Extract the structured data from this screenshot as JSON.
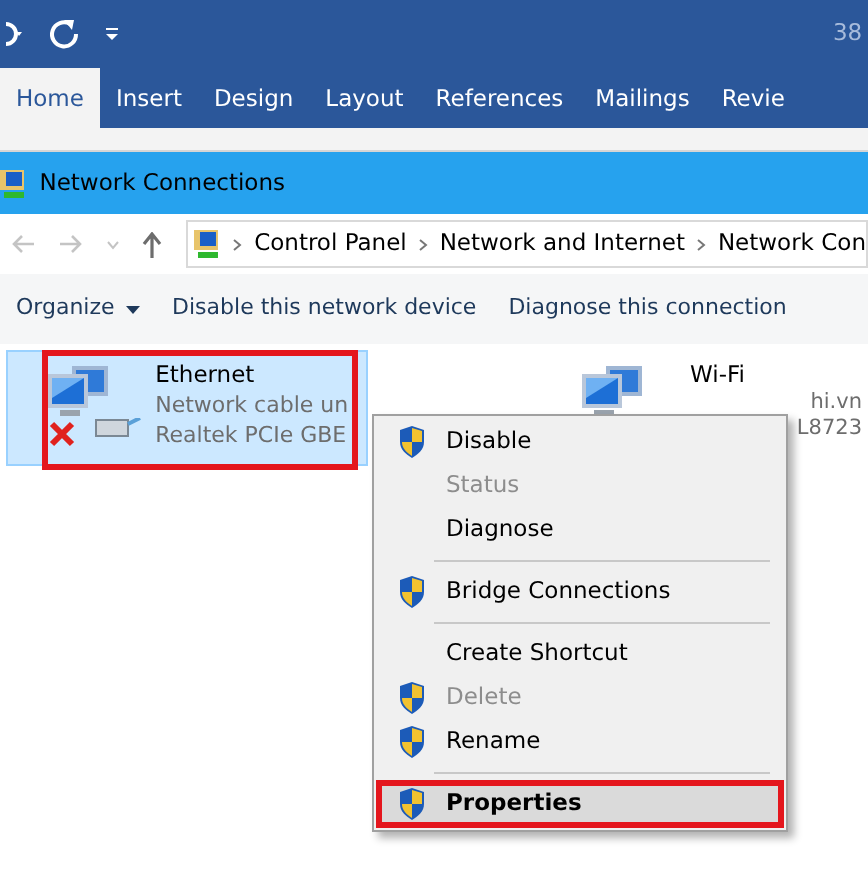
{
  "word": {
    "title_fragment": "38",
    "tabs": [
      {
        "label": "Home",
        "selected": true
      },
      {
        "label": "Insert",
        "selected": false
      },
      {
        "label": "Design",
        "selected": false
      },
      {
        "label": "Layout",
        "selected": false
      },
      {
        "label": "References",
        "selected": false
      },
      {
        "label": "Mailings",
        "selected": false
      },
      {
        "label": "Revie",
        "selected": false
      }
    ]
  },
  "window": {
    "title": "Network Connections",
    "breadcrumb": [
      "Control Panel",
      "Network and Internet",
      "Network Con"
    ]
  },
  "toolbar": [
    {
      "label": "Organize",
      "kind": "dropdown"
    },
    {
      "label": "Disable this network device",
      "kind": "button"
    },
    {
      "label": "Diagnose this connection",
      "kind": "button"
    }
  ],
  "connections": [
    {
      "name": "Ethernet",
      "lines": [
        "Network cable un",
        "Realtek PCIe GBE"
      ],
      "selected": true,
      "highlighted": true,
      "disconnected": true
    },
    {
      "name": "Wi-Fi",
      "lines": [
        "hi.vn",
        "L8723"
      ],
      "selected": false,
      "highlighted": false
    }
  ],
  "context_menu": [
    {
      "kind": "item",
      "label": "Disable",
      "shield": true,
      "disabled": false,
      "bold": false,
      "highlighted": false
    },
    {
      "kind": "item",
      "label": "Status",
      "shield": false,
      "disabled": true,
      "bold": false,
      "highlighted": false
    },
    {
      "kind": "item",
      "label": "Diagnose",
      "shield": false,
      "disabled": false,
      "bold": false,
      "highlighted": false
    },
    {
      "kind": "separator"
    },
    {
      "kind": "item",
      "label": "Bridge Connections",
      "shield": true,
      "disabled": false,
      "bold": false,
      "highlighted": false
    },
    {
      "kind": "separator"
    },
    {
      "kind": "item",
      "label": "Create Shortcut",
      "shield": false,
      "disabled": false,
      "bold": false,
      "highlighted": false
    },
    {
      "kind": "item",
      "label": "Delete",
      "shield": true,
      "disabled": true,
      "bold": false,
      "highlighted": false
    },
    {
      "kind": "item",
      "label": "Rename",
      "shield": true,
      "disabled": false,
      "bold": false,
      "highlighted": false
    },
    {
      "kind": "separator"
    },
    {
      "kind": "item",
      "label": "Properties",
      "shield": true,
      "disabled": false,
      "bold": true,
      "highlighted": true
    }
  ]
}
